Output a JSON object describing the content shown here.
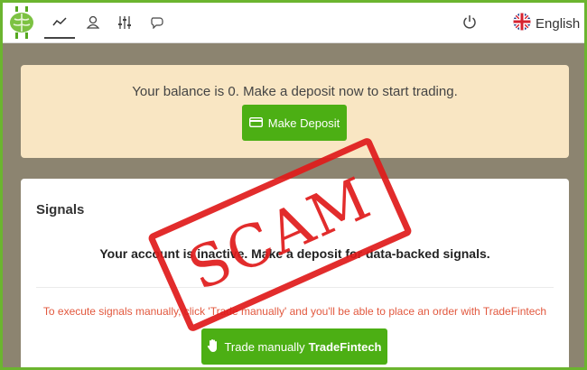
{
  "nav": {
    "icons": [
      "chart-line-icon",
      "user-icon",
      "sliders-icon",
      "chat-icon"
    ],
    "language": "English"
  },
  "banner": {
    "message": "Your balance is 0. Make a deposit now to start trading.",
    "deposit_label": "Make Deposit"
  },
  "signals": {
    "title": "Signals",
    "inactive_message": "Your account is inactive. Make a deposit for data-backed signals.",
    "manual_hint": "To execute signals manually, click 'Trade manually' and you'll be able to place an order with TradeFintech",
    "trade_label": "Trade manually",
    "trade_brand": "TradeFintech"
  },
  "stamp": {
    "text": "SCAM"
  },
  "colors": {
    "accent_green": "#4caf14",
    "banner_bg": "#f9e6c3",
    "stamp_red": "#e01b1b",
    "hint_red": "#e2583e"
  }
}
